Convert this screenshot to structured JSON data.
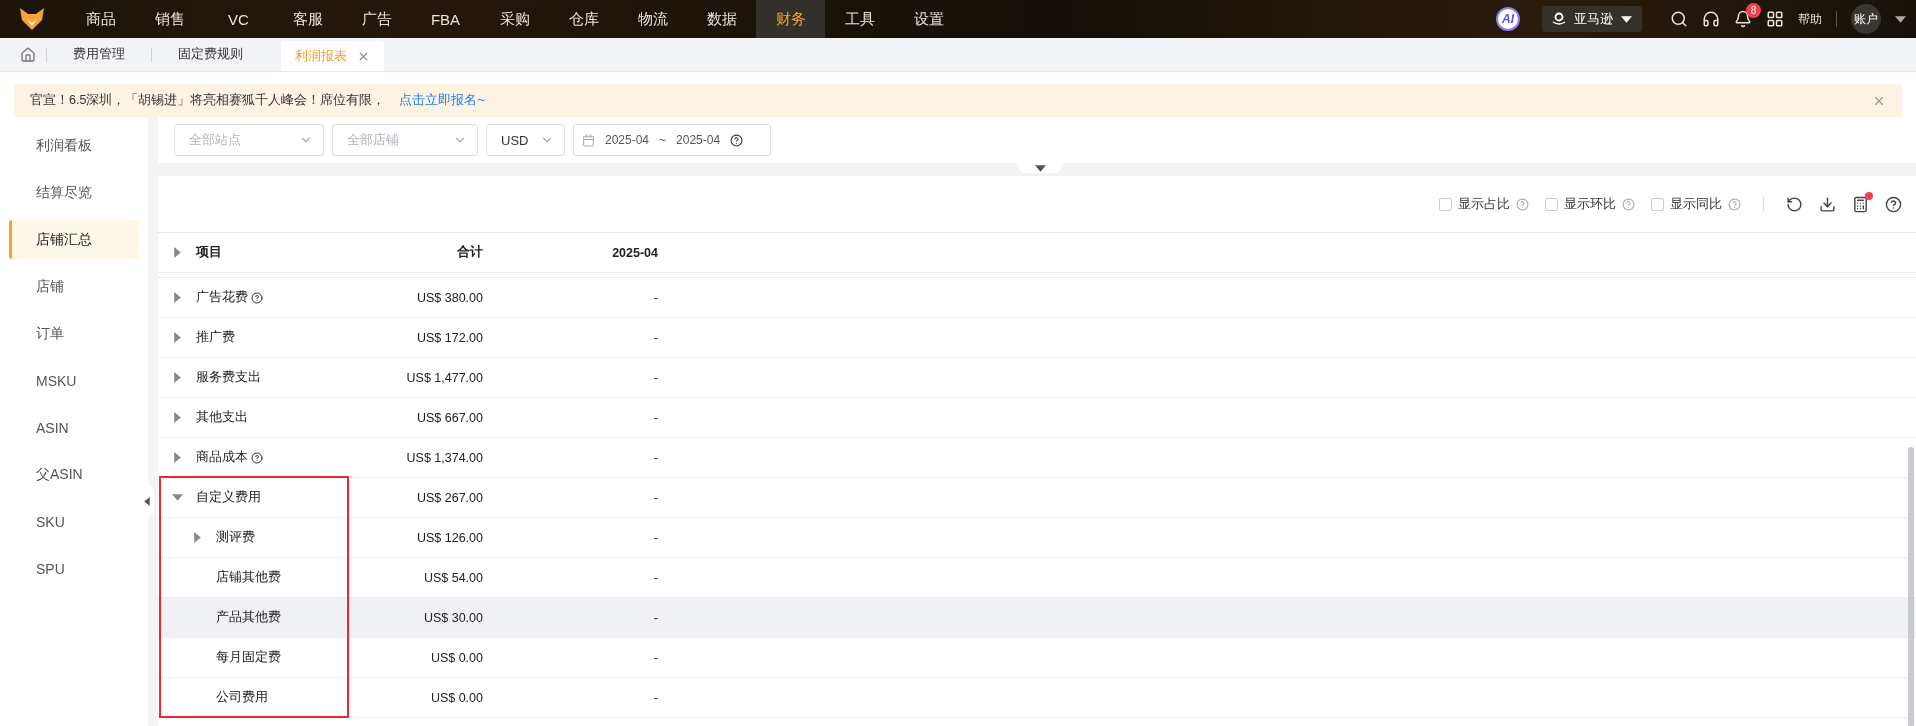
{
  "nav": {
    "items": [
      {
        "label": "商品",
        "selected": false
      },
      {
        "label": "销售",
        "selected": false
      },
      {
        "label": "VC",
        "selected": false
      },
      {
        "label": "客服",
        "selected": false
      },
      {
        "label": "广告",
        "selected": false
      },
      {
        "label": "FBA",
        "selected": false
      },
      {
        "label": "采购",
        "selected": false
      },
      {
        "label": "仓库",
        "selected": false
      },
      {
        "label": "物流",
        "selected": false
      },
      {
        "label": "数据",
        "selected": false
      },
      {
        "label": "财务",
        "selected": true
      },
      {
        "label": "工具",
        "selected": false
      },
      {
        "label": "设置",
        "selected": false
      }
    ],
    "ai_label": "AI",
    "platform": "亚马逊",
    "notifications": "8",
    "help": "帮助",
    "account": "账户"
  },
  "tabs": [
    {
      "label": "费用管理",
      "selected": false
    },
    {
      "label": "固定费规则",
      "selected": false
    },
    {
      "label": "利润报表",
      "selected": true
    }
  ],
  "banner": {
    "text": "官宣！6.5深圳，「胡锡进」将亮相赛狐千人峰会！席位有限，",
    "link": "点击立即报名~"
  },
  "sidebar": {
    "items": [
      {
        "label": "利润看板",
        "selected": false
      },
      {
        "label": "结算尽览",
        "selected": false
      },
      {
        "label": "店铺汇总",
        "selected": true
      },
      {
        "label": "店铺",
        "selected": false
      },
      {
        "label": "订单",
        "selected": false
      },
      {
        "label": "MSKU",
        "selected": false
      },
      {
        "label": "ASIN",
        "selected": false
      },
      {
        "label": "父ASIN",
        "selected": false
      },
      {
        "label": "SKU",
        "selected": false
      },
      {
        "label": "SPU",
        "selected": false
      }
    ]
  },
  "filters": {
    "site": {
      "placeholder": "全部站点"
    },
    "store": {
      "placeholder": "全部店铺"
    },
    "currency": {
      "value": "USD"
    },
    "date": {
      "start": "2025-04",
      "separator": "~",
      "end": "2025-04"
    }
  },
  "toolbar": {
    "options": [
      {
        "label": "显示占比",
        "checked": false
      },
      {
        "label": "显示环比",
        "checked": false
      },
      {
        "label": "显示同比",
        "checked": false
      }
    ],
    "notice_dot": true
  },
  "table": {
    "columns": [
      "项目",
      "合计",
      "2025-04"
    ],
    "rows": [
      {
        "label": "广告花费",
        "has_help": true,
        "total": "US$ 380.00",
        "month": "-",
        "expanded": false
      },
      {
        "label": "推广费",
        "total": "US$ 172.00",
        "month": "-",
        "expanded": false
      },
      {
        "label": "服务费支出",
        "total": "US$ 1,477.00",
        "month": "-",
        "expanded": false
      },
      {
        "label": "其他支出",
        "total": "US$ 667.00",
        "month": "-",
        "expanded": false
      },
      {
        "label": "商品成本",
        "has_help": true,
        "total": "US$ 1,374.00",
        "month": "-",
        "expanded": false
      },
      {
        "label": "自定义费用",
        "total": "US$ 267.00",
        "month": "-",
        "expanded": true,
        "highlighted": true,
        "children": [
          {
            "label": "测评费",
            "total": "US$ 126.00",
            "month": "-",
            "expanded": false
          },
          {
            "label": "店铺其他费",
            "total": "US$ 54.00",
            "month": "-"
          },
          {
            "label": "产品其他费",
            "total": "US$ 30.00",
            "month": "-",
            "hovered": true
          },
          {
            "label": "每月固定费",
            "total": "US$ 0.00",
            "month": "-"
          },
          {
            "label": "公司费用",
            "total": "US$ 0.00",
            "month": "-"
          }
        ]
      }
    ]
  }
}
